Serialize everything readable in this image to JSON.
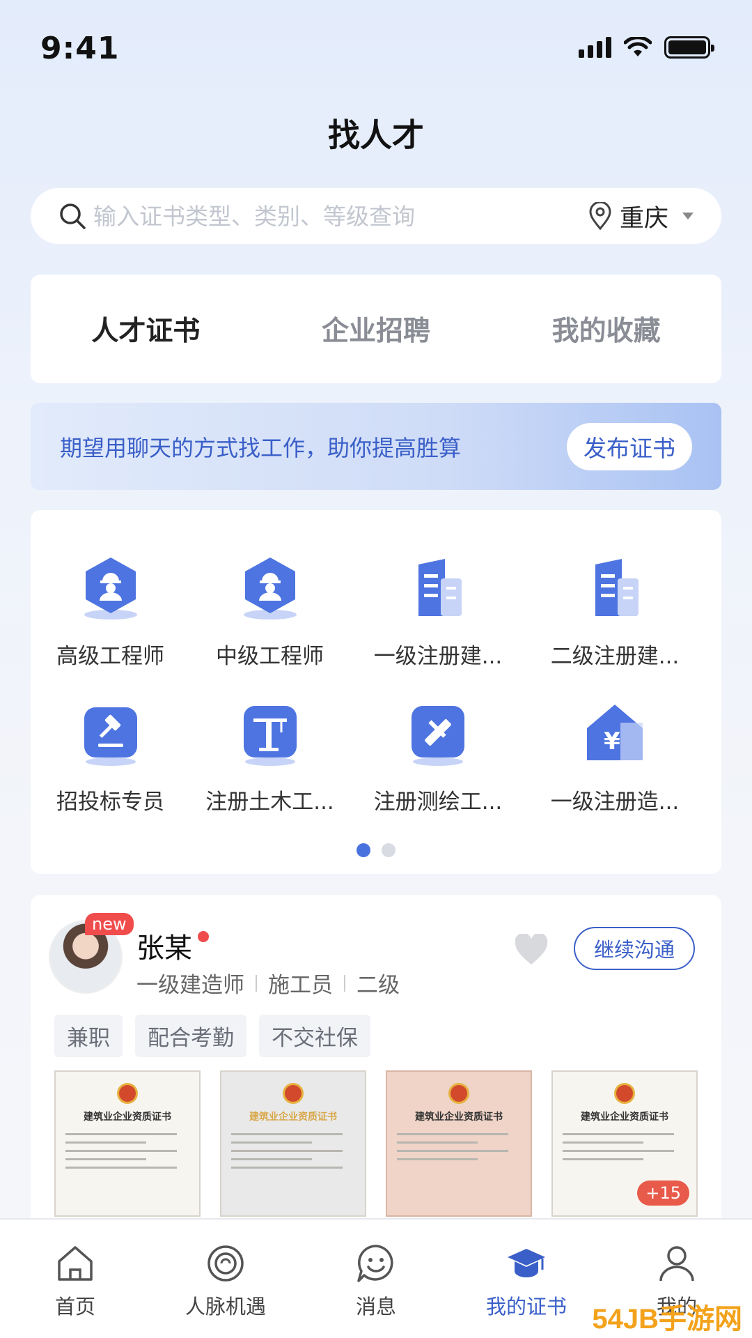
{
  "status": {
    "time": "9:41",
    "signal_icon": "cellular-signal-icon",
    "wifi_icon": "wifi-icon",
    "battery_icon": "battery-icon"
  },
  "header": {
    "title": "找人才"
  },
  "search": {
    "placeholder": "输入证书类型、类别、等级查询",
    "city": "重庆",
    "search_icon": "search-icon",
    "location_icon": "location-pin-icon"
  },
  "tabs": [
    {
      "label": "人才证书",
      "active": true
    },
    {
      "label": "企业招聘",
      "active": false
    },
    {
      "label": "我的收藏",
      "active": false
    }
  ],
  "banner": {
    "text": "期望用聊天的方式找工作，助你提高胜算",
    "button": "发布证书"
  },
  "categories": [
    {
      "label": "高级工程师",
      "icon": "engineer-helmet-icon"
    },
    {
      "label": "中级工程师",
      "icon": "engineer-helmet-icon"
    },
    {
      "label": "一级注册建...",
      "icon": "building-icon"
    },
    {
      "label": "二级注册建...",
      "icon": "building-icon"
    },
    {
      "label": "招投标专员",
      "icon": "gavel-icon"
    },
    {
      "label": "注册土木工...",
      "icon": "crane-icon"
    },
    {
      "label": "注册测绘工...",
      "icon": "ruler-pencil-icon"
    },
    {
      "label": "一级注册造...",
      "icon": "yuan-house-icon"
    }
  ],
  "pager": {
    "pages": 2,
    "current": 1
  },
  "talent": {
    "badge": "new",
    "name": "张某",
    "meta": [
      "一级建造师",
      "施工员",
      "二级"
    ],
    "contact_button": "继续沟通",
    "tags": [
      "兼职",
      "配合考勤",
      "不交社保"
    ],
    "certificates": [
      {
        "title": "建筑业企业资质证书",
        "style": "white"
      },
      {
        "title": "建筑业企业资质证书",
        "style": "gray"
      },
      {
        "title": "建筑业企业资质证书",
        "style": "pink"
      },
      {
        "title": "建筑业企业资质证书",
        "style": "white"
      }
    ],
    "more_count": "+15"
  },
  "nav": [
    {
      "label": "首页",
      "icon": "home-icon",
      "active": false
    },
    {
      "label": "人脉机遇",
      "icon": "network-circle-icon",
      "active": false
    },
    {
      "label": "消息",
      "icon": "message-smile-icon",
      "active": false
    },
    {
      "label": "我的证书",
      "icon": "graduation-cap-icon",
      "active": true
    },
    {
      "label": "我的",
      "icon": "person-icon",
      "active": false
    }
  ],
  "watermark": "54JB手游网",
  "colors": {
    "accent": "#3a5fc8",
    "accent_light": "#4a72df",
    "badge_red": "#f04c4c"
  }
}
